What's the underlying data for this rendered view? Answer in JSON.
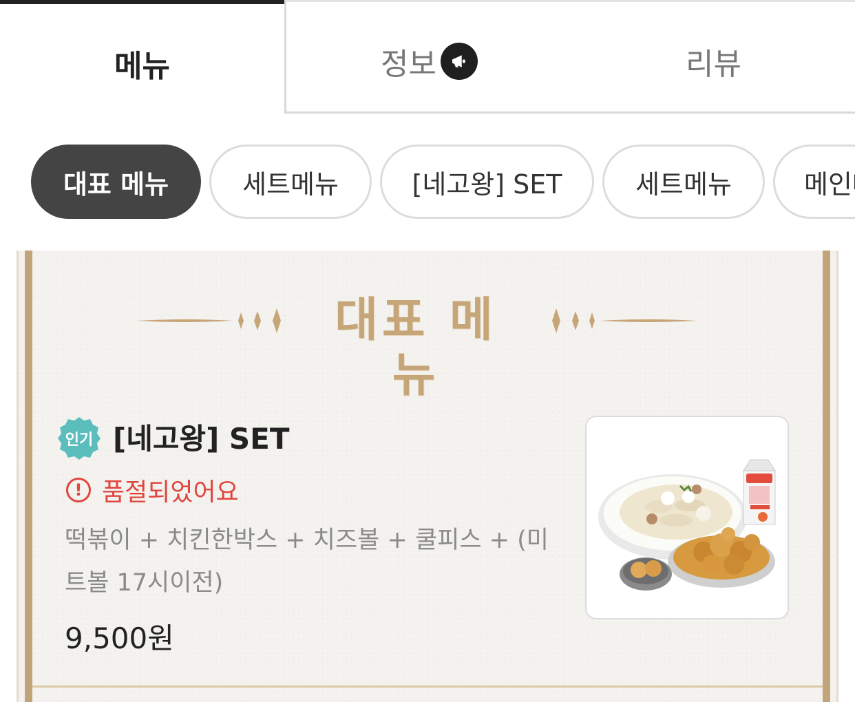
{
  "tabs": {
    "menu": "메뉴",
    "info": "정보",
    "review": "리뷰"
  },
  "chips": [
    "대표 메뉴",
    "세트메뉴",
    "[네고왕] SET",
    "세트메뉴",
    "메인메뉴"
  ],
  "section": {
    "title": "대표 메뉴"
  },
  "item": {
    "badge": "인기",
    "name": "[네고왕] SET",
    "status": "품절되었어요",
    "description": "떡볶이 + 치킨한박스 + 치즈볼 + 쿨피스 + (미트볼 17시이전)",
    "price": "9,500원",
    "image_alt": "네고왕 SET 사진"
  },
  "colors": {
    "active_tab": "#222222",
    "active_chip": "#444444",
    "gold": "#c6a678",
    "frame": "#c2a47a",
    "soldout": "#e0453f",
    "badge": "#5cbdbd"
  },
  "icons": {
    "info_badge": "megaphone-icon",
    "soldout": "alert-circle-icon"
  }
}
